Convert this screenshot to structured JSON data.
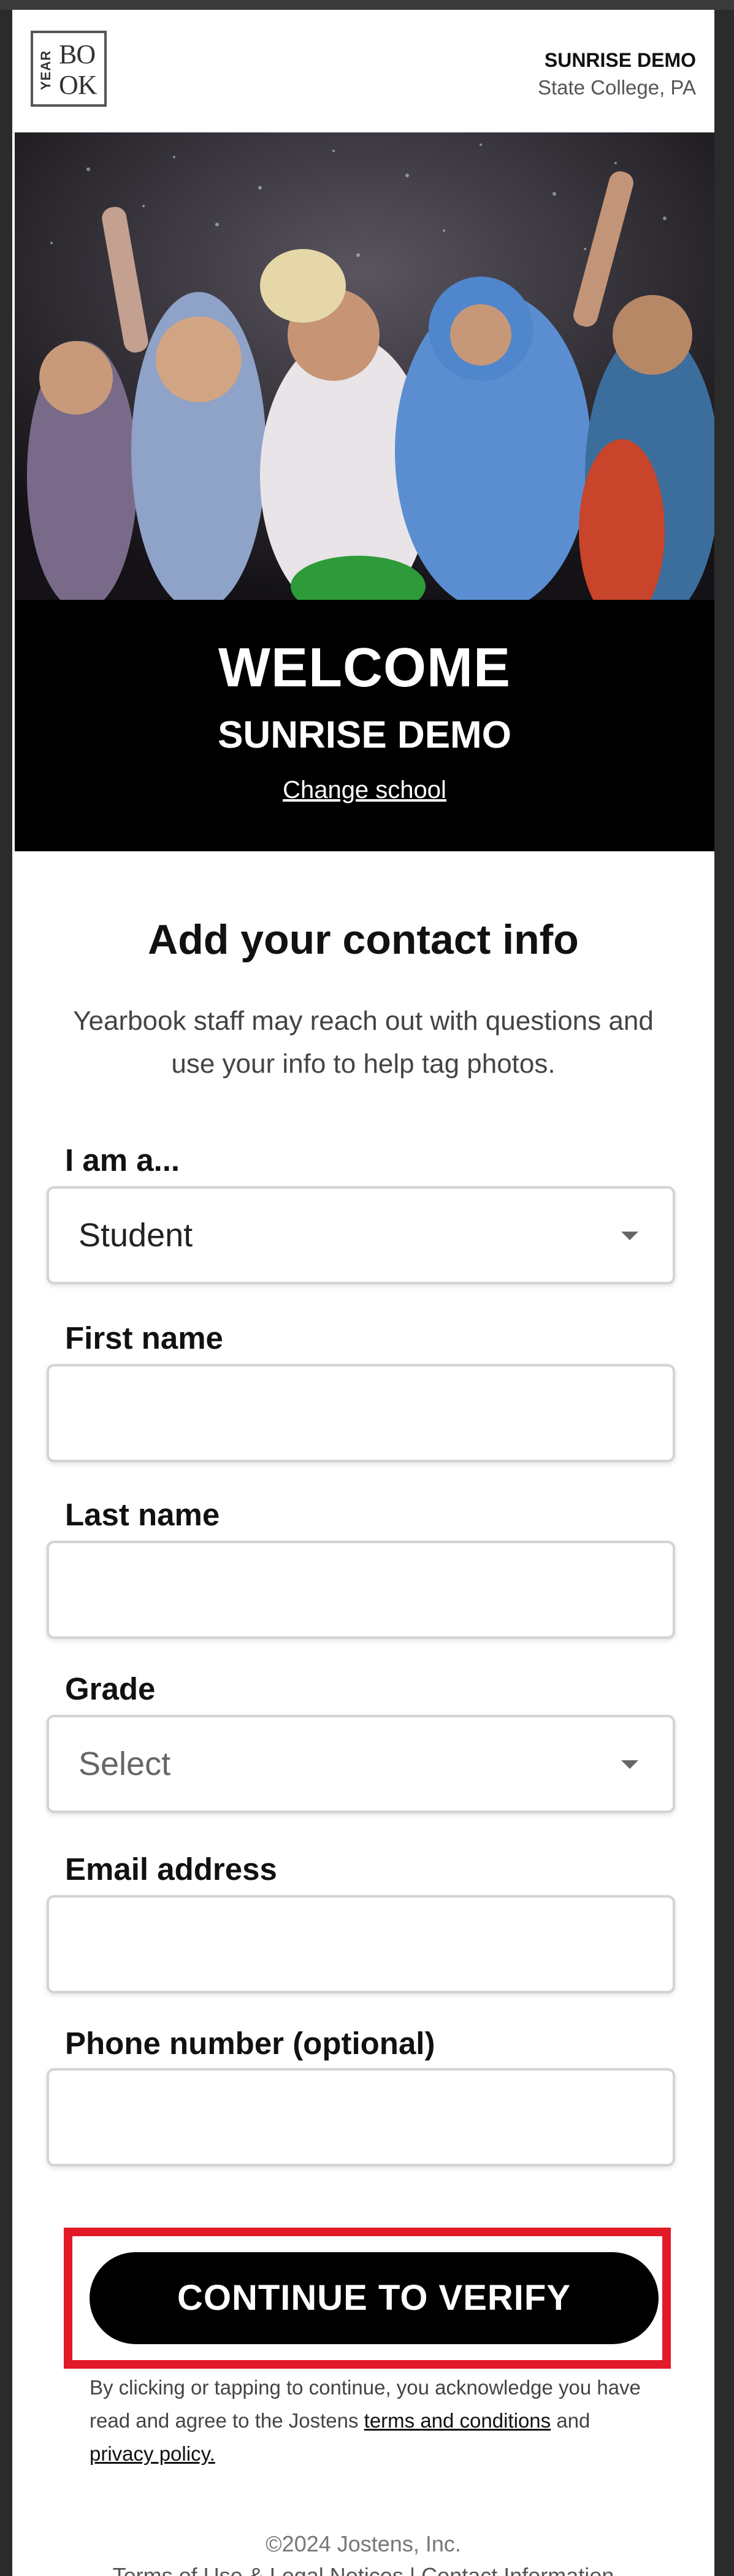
{
  "header": {
    "logo_side": "YEAR",
    "logo_main": "BO OK",
    "school_name": "SUNRISE DEMO",
    "school_location": "State College, PA"
  },
  "banner": {
    "welcome": "WELCOME",
    "school": "SUNRISE DEMO",
    "change_school": "Change school"
  },
  "form": {
    "title": "Add your contact info",
    "subtitle": "Yearbook staff may reach out with questions and use your info to help tag photos.",
    "role": {
      "label": "I am a...",
      "value": "Student"
    },
    "first_name": {
      "label": "First name",
      "value": ""
    },
    "last_name": {
      "label": "Last name",
      "value": ""
    },
    "grade": {
      "label": "Grade",
      "value": "Select"
    },
    "email": {
      "label": "Email address",
      "value": ""
    },
    "phone": {
      "label": "Phone number (optional)",
      "value": ""
    }
  },
  "cta": {
    "label": "CONTINUE TO VERIFY"
  },
  "disclaimer": {
    "text_before": "By clicking or tapping to continue, you acknowledge you have read and agree to the Jostens ",
    "terms_link": "terms and conditions",
    "and": " and ",
    "privacy_link": "privacy policy."
  },
  "footer": {
    "copyright": "©2024 Jostens, Inc.",
    "links": "Terms of Use & Legal Notices | Contact Information"
  },
  "colors": {
    "accent_outline": "#e21a28",
    "button": "#000000",
    "banner": "#000000"
  }
}
